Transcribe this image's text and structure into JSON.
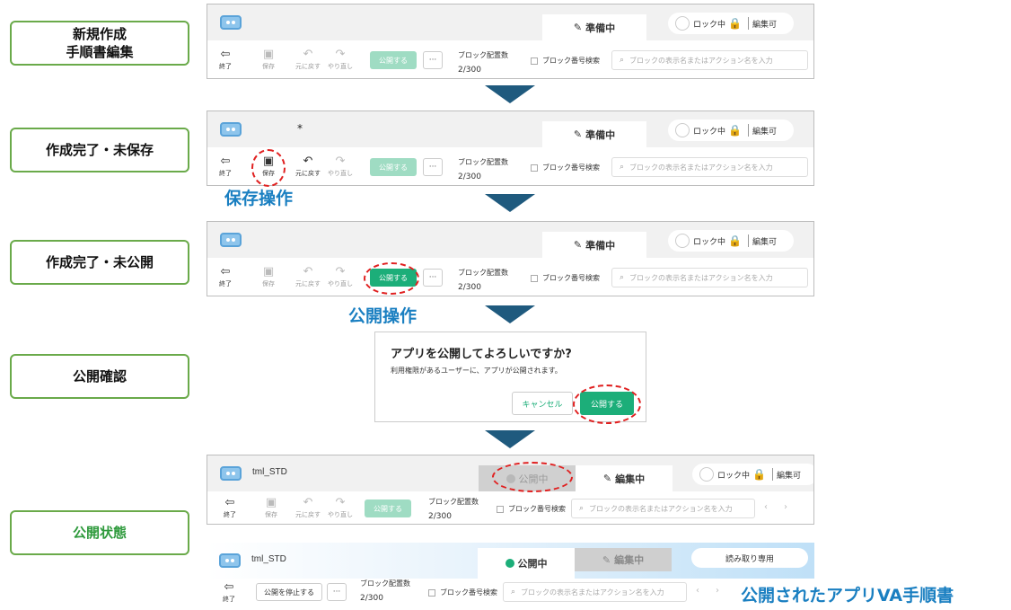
{
  "stages": [
    {
      "line1": "新規作成",
      "line2": "手順書編集"
    },
    {
      "line1": "作成完了・未保存"
    },
    {
      "line1": "作成完了・未公開"
    },
    {
      "line1": "公開確認"
    },
    {
      "line1": "公開状態"
    }
  ],
  "toolbar": {
    "exit": "終了",
    "save": "保存",
    "undo": "元に戻す",
    "redo": "やり直し",
    "publish": "公開する",
    "stop_publish": "公開を停止する",
    "more": "···",
    "block_count_label": "ブロック配置数",
    "block_count_value": "2/300",
    "block_search_label": "ブロック番号検索",
    "search_placeholder": "ブロックの表示名またはアクション名を入力"
  },
  "header": {
    "app_name": "tml_STD",
    "unsaved_mark": "*",
    "tab_preparing": "準備中",
    "tab_published": "公開中",
    "tab_editing": "編集中",
    "lock_label": "ロック中",
    "editable_label": "編集可",
    "readonly_label": "読み取り専用"
  },
  "captions": {
    "save_op": "保存操作",
    "publish_op": "公開操作",
    "published_app": "公開されたアプリVA手順書"
  },
  "dialog": {
    "title": "アプリを公開してよろしいですか?",
    "message": "利用権限があるユーザーに、アプリが公開されます。",
    "cancel": "キャンセル",
    "confirm": "公開する"
  },
  "colors": {
    "accent_green": "#1cae79",
    "arrow": "#1f5a7e",
    "caption_blue": "#1a7fc1",
    "highlight": "#e02020"
  }
}
